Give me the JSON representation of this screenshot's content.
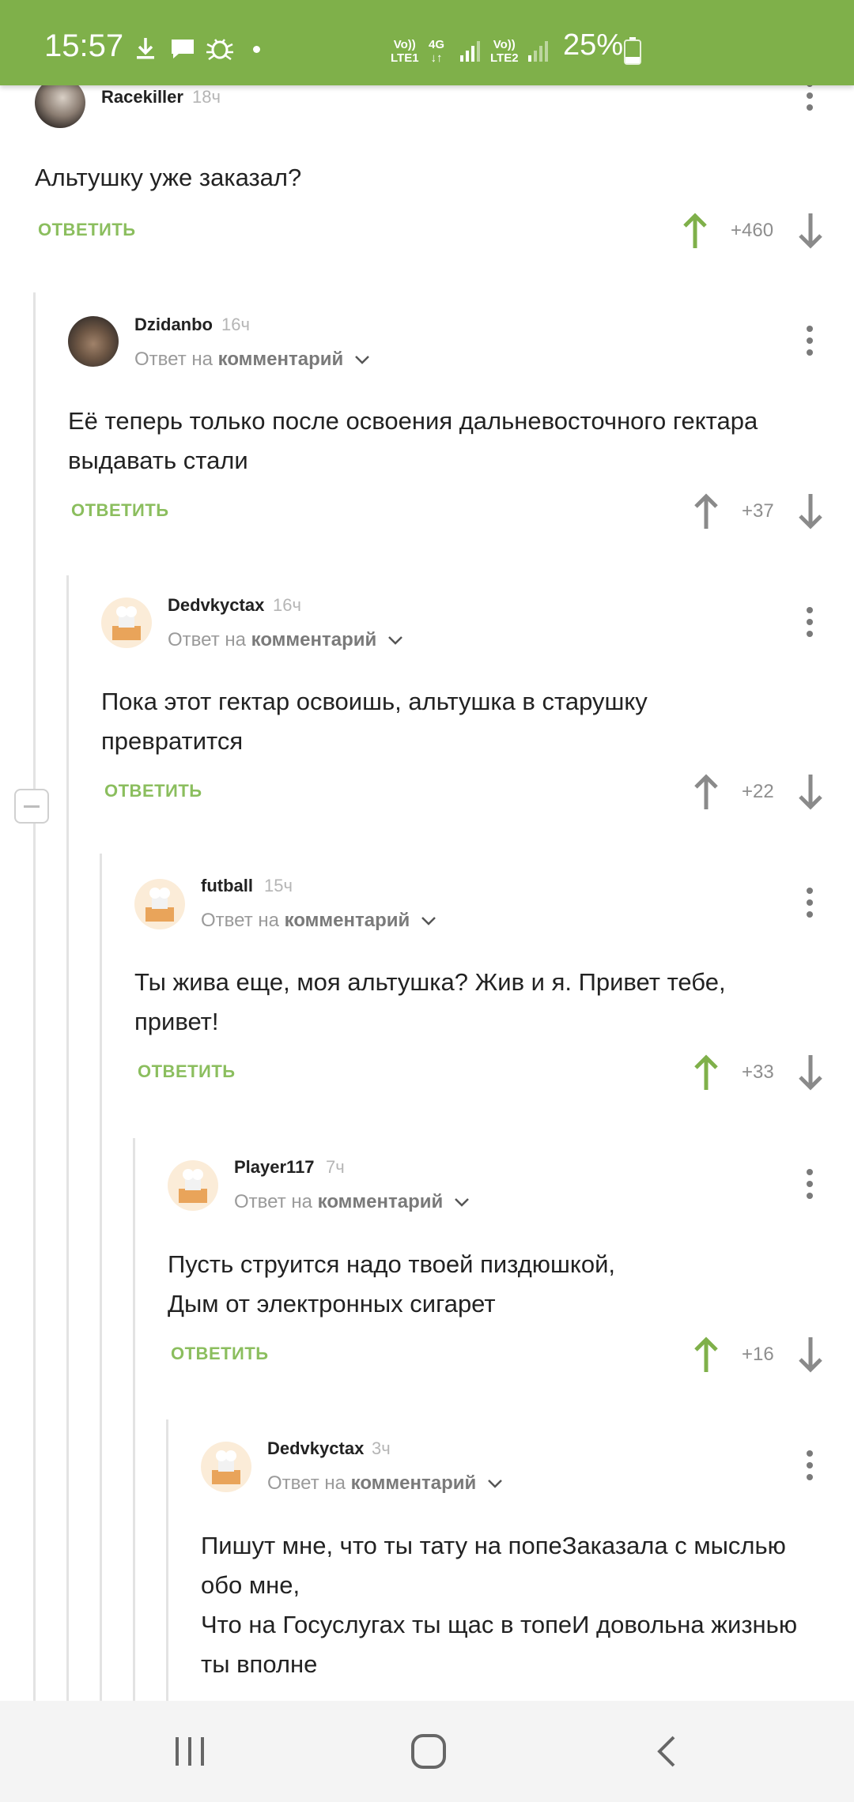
{
  "status_bar": {
    "time": "15:57",
    "battery": "25%",
    "network": [
      "Vo))",
      "LTE1",
      "4G",
      "Vo))",
      "LTE2"
    ],
    "icons": [
      "download-icon",
      "message-icon",
      "bug-icon"
    ]
  },
  "comments": [
    {
      "author": "Racekiller",
      "time": "18ч",
      "reply_to": "",
      "text": "Альтушку уже заказал?",
      "reply": "ОТВЕТИТЬ",
      "score": "+460",
      "voted_up": true
    },
    {
      "author": "Dzidanbo",
      "time": "16ч",
      "reply_to_prefix": "Ответ на",
      "reply_to": "комментарий",
      "text": "Её теперь только после освоения дальневосточного гектара выдавать стали",
      "reply": "ОТВЕТИТЬ",
      "score": "+37",
      "voted_up": false
    },
    {
      "author": "Dedvkyctax",
      "time": "16ч",
      "reply_to_prefix": "Ответ на",
      "reply_to": "комментарий",
      "text": "Пока этот гектар освоишь, альтушка в старушку превратится",
      "reply": "ОТВЕТИТЬ",
      "score": "+22",
      "voted_up": false
    },
    {
      "author": "futball",
      "time": "15ч",
      "reply_to_prefix": "Ответ на",
      "reply_to": "комментарий",
      "text": "Ты жива еще, моя альтушка? Жив и я. Привет тебе, привет!",
      "reply": "ОТВЕТИТЬ",
      "score": "+33",
      "voted_up": true
    },
    {
      "author": "Player117",
      "time": "7ч",
      "reply_to_prefix": "Ответ на",
      "reply_to": "комментарий",
      "text_lines": [
        "Пусть струится надо твоей пиздюшкой,",
        "Дым от электронных сигарет"
      ],
      "reply": "ОТВЕТИТЬ",
      "score": "+16",
      "voted_up": true
    },
    {
      "author": "Dedvkyctax",
      "time": "3ч",
      "reply_to_prefix": "Ответ на",
      "reply_to": "комментарий",
      "text_lines": [
        "Пишут мне, что ты тату на попеЗаказала с мыслью обо мне,",
        "Что на Госуслугах ты щас в топеИ довольна жизнью ты вполне"
      ]
    }
  ],
  "colors": {
    "accent": "#7fb04a",
    "upvote": "#7fb04a",
    "reply": "#8bbe5e",
    "neutral_arrow": "#8a8a8a"
  }
}
